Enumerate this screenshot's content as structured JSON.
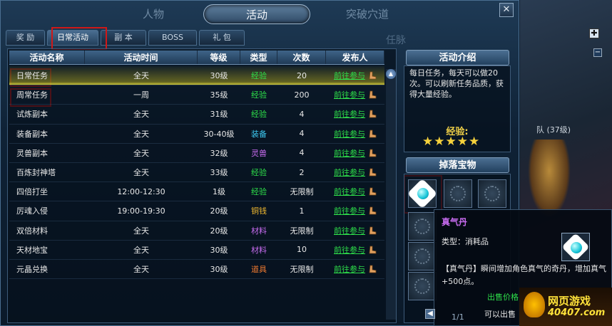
{
  "header": {
    "tabs": [
      "人物",
      "活动",
      "突破穴道"
    ],
    "close_label": "✕"
  },
  "subtabs": [
    "奖 励",
    "日常活动",
    "副 本",
    "BOSS",
    "礼 包"
  ],
  "right_sub_ghost": "任脉",
  "table": {
    "headers": [
      "活动名称",
      "活动时间",
      "等级",
      "类型",
      "次数",
      "发布人"
    ],
    "rows": [
      {
        "name": "日常任务",
        "time": "全天",
        "level": "30级",
        "type": "经验",
        "count": "20",
        "action": "前往参与"
      },
      {
        "name": "周常任务",
        "time": "一周",
        "level": "35级",
        "type": "经验",
        "count": "200",
        "action": "前往参与"
      },
      {
        "name": "试炼副本",
        "time": "全天",
        "level": "31级",
        "type": "经验",
        "count": "4",
        "action": "前往参与"
      },
      {
        "name": "装备副本",
        "time": "全天",
        "level": "30-40级",
        "type": "装备",
        "count": "4",
        "action": "前往参与"
      },
      {
        "name": "灵兽副本",
        "time": "全天",
        "level": "32级",
        "type": "灵兽",
        "count": "4",
        "action": "前往参与"
      },
      {
        "name": "百炼封神塔",
        "time": "全天",
        "level": "33级",
        "type": "经验",
        "count": "2",
        "action": "前往参与"
      },
      {
        "name": "四倍打坐",
        "time": "12:00-12:30",
        "level": "1级",
        "type": "经验",
        "count": "无限制",
        "action": "前往参与"
      },
      {
        "name": "厉魂入侵",
        "time": "19:00-19:30",
        "level": "20级",
        "type": "铜钱",
        "count": "1",
        "action": "前往参与"
      },
      {
        "name": "双倍材料",
        "time": "全天",
        "level": "20级",
        "type": "材料",
        "count": "无限制",
        "action": "前往参与"
      },
      {
        "name": "天材地宝",
        "time": "全天",
        "level": "30级",
        "type": "材料",
        "count": "10",
        "action": "前往参与"
      },
      {
        "name": "元晶兑换",
        "time": "全天",
        "level": "30级",
        "type": "道具",
        "count": "无限制",
        "action": "前往参与"
      }
    ]
  },
  "type_colors": {
    "经验": "#2ee04a",
    "装备": "#3ec8f0",
    "灵兽": "#c86cf0",
    "铜钱": "#f0b830",
    "材料": "#c86cf0",
    "道具": "#f07a30"
  },
  "intro": {
    "title": "活动介绍",
    "text": "每日任务，每天可以做20次。可以刷新任务品质，获得大量经验。",
    "exp_label": "经验:",
    "stars": 5
  },
  "drops": {
    "title": "掉落宝物"
  },
  "tooltip": {
    "name": "真气丹",
    "type": "类型：消耗品",
    "desc": "【真气丹】瞬间增加角色真气的奇丹，增加真气+500点。",
    "price": "出售价格：",
    "price2": "可以出售",
    "page": "1/1"
  },
  "scene": {
    "team": "队 (37级)",
    "plus": "✚",
    "minus": "−"
  },
  "watermark": {
    "main": "网页游戏",
    "sub": "40407.com"
  }
}
